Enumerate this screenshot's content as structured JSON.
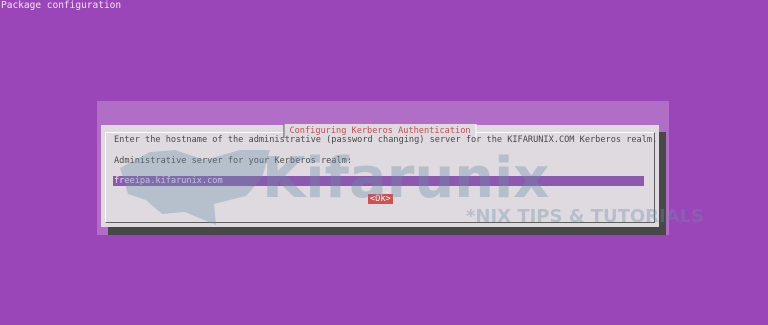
{
  "window": {
    "title": "Package configuration"
  },
  "dialog": {
    "title": "Configuring Kerberos Authentication",
    "message": "Enter the hostname of the administrative (password changing) server for the KIFARUNIX.COM Kerberos realm.",
    "prompt": "Administrative server for your Kerberos realm:",
    "input_value": "freeipa.kifarunix.com",
    "ok_label": "<Ok>"
  },
  "watermark": {
    "brand": "Kifarunix",
    "tagline": "*NIX TIPS & TUTORIALS"
  },
  "colors": {
    "background": "#9b46b8",
    "dialog_bg": "#d7d0d7",
    "title_text": "#b02020",
    "input_bg": "#6c2a9a",
    "button_bg": "#c41f1f"
  }
}
